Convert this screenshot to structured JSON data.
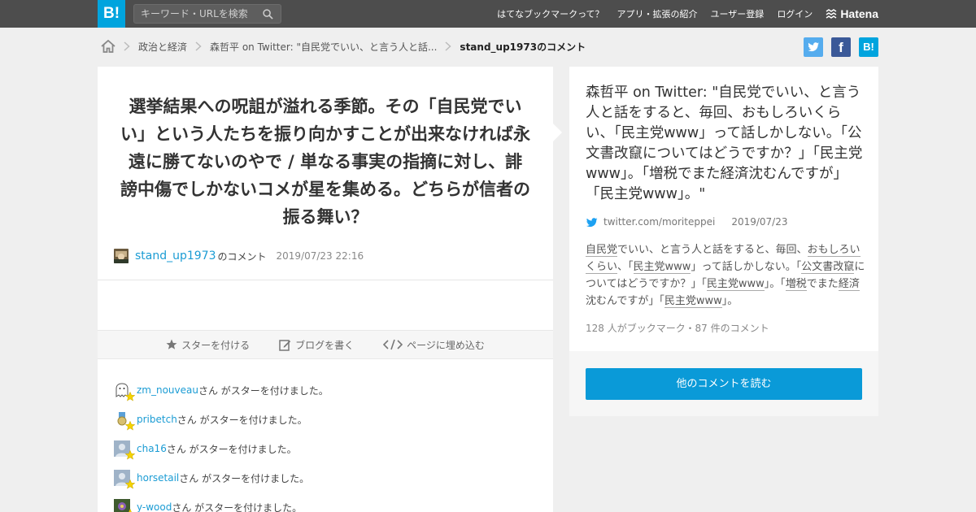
{
  "header": {
    "logo": "B!",
    "search_placeholder": "キーワード・URLを検索",
    "nav": [
      "はてなブックマークって？",
      "アプリ・拡張の紹介",
      "ユーザー登録",
      "ログイン"
    ],
    "brand": "Hatena"
  },
  "breadcrumb": {
    "items": [
      "政治と経済",
      "森哲平 on Twitter: \"自民党でいい、と言う人と話...",
      "stand_up1973のコメント"
    ]
  },
  "share": {
    "facebook": "f",
    "hatena": "B!"
  },
  "comment": {
    "text": "選挙結果への呪詛が溢れる季節。その「自民党でいい」という人たちを振り向かすことが出来なければ永遠に勝てないのやで / 単なる事実の指摘に対し、誹謗中傷でしかないコメが星を集める。どちらが信者の振る舞い？",
    "user": "stand_up1973",
    "suffix": "のコメント",
    "time": "2019/07/23 22:16"
  },
  "actions": {
    "star": "スターを付ける",
    "blog": "ブログを書く",
    "embed": "ページに埋め込む"
  },
  "stars": [
    {
      "user": "zm_nouveau",
      "msg": "さん がスターを付けました。"
    },
    {
      "user": "pribetch",
      "msg": "さん がスターを付けました。"
    },
    {
      "user": "cha16",
      "msg": "さん がスターを付けました。"
    },
    {
      "user": "horsetail",
      "msg": "さん がスターを付けました。"
    },
    {
      "user": "y-wood",
      "msg": "さん がスターを付けました。"
    }
  ],
  "entry": {
    "title": "森哲平 on Twitter: \"自民党でいい、と言う人と話をすると、毎回、おもしろいくらい、「民主党www」って話しかしない。「公文書改竄についてはどうですか？」「民主党www」。「増税でまた経済沈むんですが」「民主党www」。\"",
    "domain": "twitter.com/moriteppei",
    "date": "2019/07/23",
    "summary": {
      "s1": "自民党",
      "s2": "でいい、と言う人と話をすると、毎回、",
      "s3": "おもしろいくらい",
      "s4": "、「",
      "s5": "民主党www",
      "s6": "」って話しかしない。「",
      "s7": "公文書改竄",
      "s8": "についてはどうですか？」「",
      "s9": "民主党www",
      "s10": "」。「",
      "s11": "増税",
      "s12": "でまた",
      "s13": "経済",
      "s14": "沈むんですが」「",
      "s15": "民主党www",
      "s16": "」。"
    },
    "stats": "128 人がブックマーク・87 件のコメント",
    "read_more": "他のコメントを読む"
  },
  "colors": {
    "accent": "#00a4de",
    "header_bg": "#4d4d4d",
    "link": "#1b9cd4",
    "button": "#0a9ad8",
    "twitter": "#55acee",
    "facebook": "#3b5998"
  }
}
